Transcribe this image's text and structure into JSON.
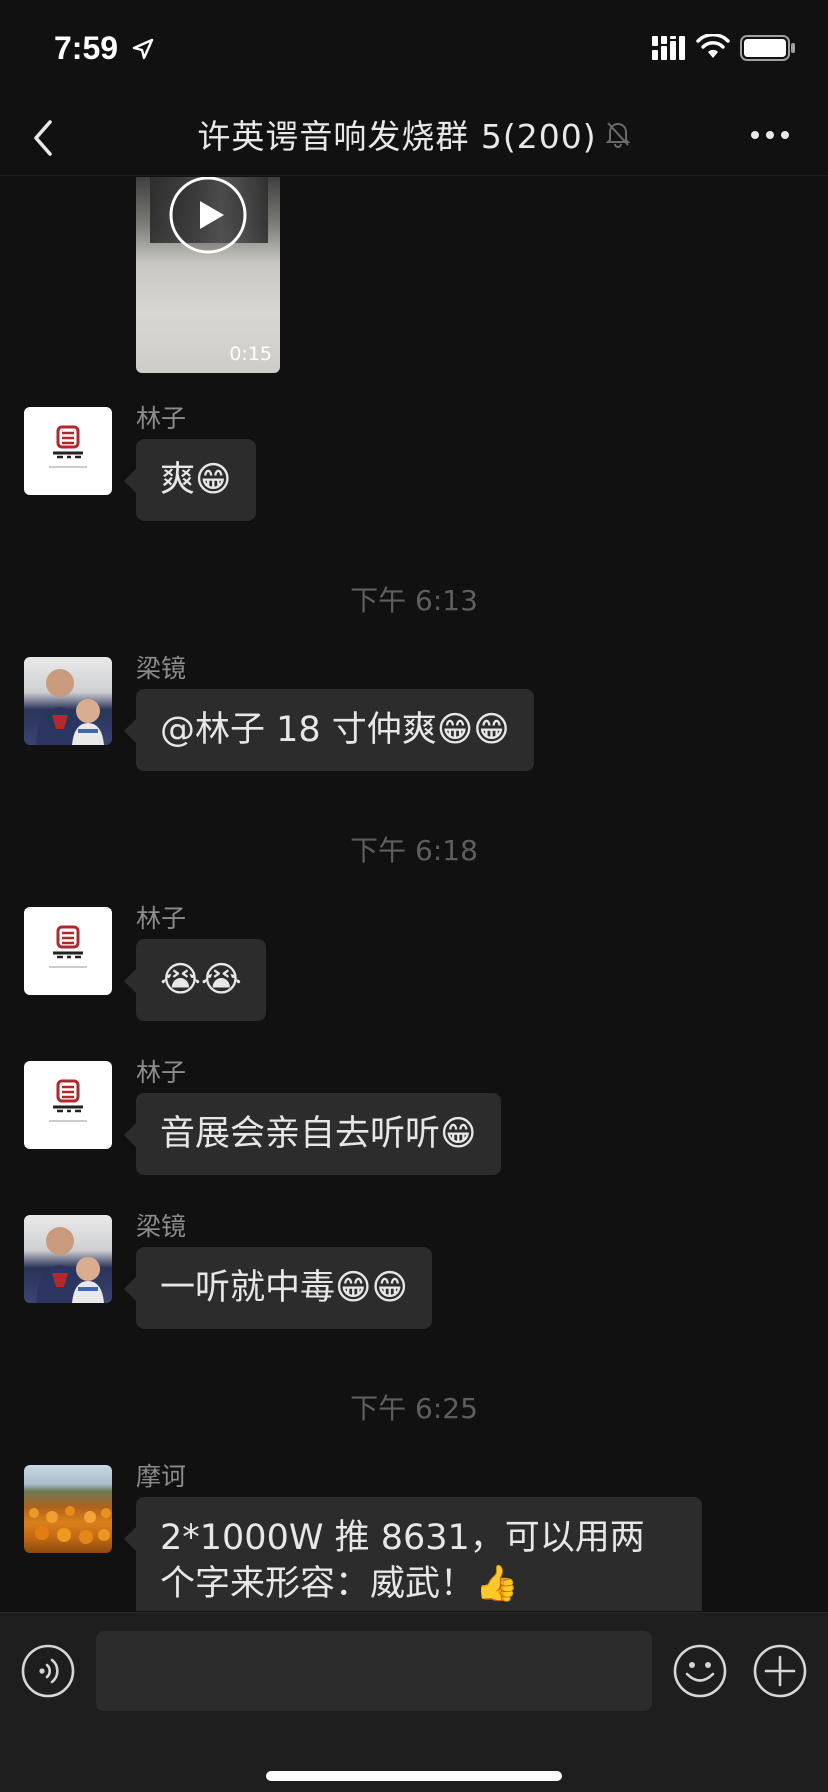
{
  "status_bar": {
    "time": "7:59"
  },
  "nav": {
    "title": "许英谔音响发烧群 5(200)"
  },
  "video": {
    "duration": "0:15"
  },
  "messages": [
    {
      "sender": "林子",
      "text": "爽😁"
    },
    {
      "sender": "梁镜",
      "text": "@林子 18 寸仲爽😁😁"
    },
    {
      "sender": "林子",
      "text": "😭😭"
    },
    {
      "sender": "林子",
      "text": "音展会亲自去听听😁"
    },
    {
      "sender": "梁镜",
      "text": "一听就中毒😁😁"
    },
    {
      "sender": "摩诃",
      "text": "2*1000W 推 8631，可以用两个字来形容：威武！👍"
    }
  ],
  "timestamps": [
    "下午 6:13",
    "下午 6:18",
    "下午 6:25"
  ],
  "avatars": {
    "logo_text": "丰园建筑"
  },
  "input": {
    "value": ""
  }
}
